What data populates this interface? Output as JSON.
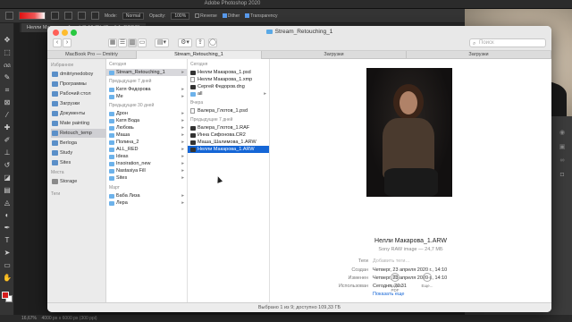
{
  "photoshop": {
    "app_title": "Adobe Photoshop 2020",
    "options": {
      "mode_label": "Mode:",
      "mode_value": "Normal",
      "opacity_label": "Opacity:",
      "opacity_value": "100%",
      "reverse_label": "Reverse",
      "dither_label": "Dither",
      "transparency_label": "Transparency",
      "reverse_checked": false,
      "dither_checked": true,
      "transparency_checked": true
    },
    "doc_tab": "Нелли Макарова_1.psd @ 16,7% (Слой 1, RGB/8)",
    "status_zoom": "16,67%",
    "status_doc": "4000 px x 6000 px (300 ppi)",
    "fg_color": "#d41c1c",
    "bg_color": "#ffffff"
  },
  "finder": {
    "window_title": "Stream_Retouching_1",
    "search_placeholder": "Поиск",
    "path_tabs": [
      "MacBook Pro — Dmitriy",
      "Stream_Retouching_1",
      "Загрузки",
      "Загрузки"
    ],
    "sidebar": {
      "favorites_heading": "Избранное",
      "favorites": [
        "dmitriynedoboy",
        "Программы",
        "Рабочий стол",
        "Загрузки",
        "Документы",
        "Mate painting",
        "Retouch_temp",
        "Berloga",
        "Study",
        "Sites"
      ],
      "selected_index": 6,
      "places_heading": "Места",
      "places": [
        "Storage"
      ],
      "tags_heading": "Теги"
    },
    "column1": {
      "today_heading": "Сегодня",
      "today": [
        {
          "label": "Stream_Retouching_1",
          "selected": true
        }
      ],
      "prev7_heading": "Предыдущие 7 дней",
      "prev7": [
        "Катя Федорова",
        "Me"
      ],
      "prev30_heading": "Предыдущие 30 дней",
      "prev30": [
        "Дрон",
        "Катя Вода",
        "Любовь",
        "Маша",
        "Полина_2",
        "ALL_RED",
        "Ideas",
        "Insoiration_new",
        "Nastasiya Fill",
        "Sites"
      ],
      "march_heading": "Март",
      "march": [
        "Баба Лиза",
        "Лера"
      ]
    },
    "column2": {
      "today_heading": "Сегодня",
      "today": [
        "Нелли Макарова_1.psd",
        "Нелли Макарова_1.xmp",
        "Сергей Федоров.dng",
        "all"
      ],
      "yesterday_heading": "Вчера",
      "yesterday": [
        "Валера_Глотов_1.psd"
      ],
      "prev7_heading": "Предыдущие 7 дней",
      "prev7": [
        "Валера_Глотов_1.RAF",
        "Инна Сифонова.CR2",
        "Маша_Шалимова_1.ARW",
        "Нелли Макарова_1.ARW"
      ],
      "highlight": "Нелли Макарова_1.ARW"
    },
    "preview": {
      "file_name": "Нелли Макарова_1.ARW",
      "file_kind": "Sony RAW image — 24,7 МБ",
      "tags_key": "Теги",
      "tags_value": "Добавить теги…",
      "created_key": "Создан",
      "created_value": "Четверг, 23 апреля 2020 г., 14:10",
      "modified_key": "Изменен",
      "modified_value": "Четверг, 23 апреля 2020 г., 14:10",
      "used_key": "Использован",
      "used_value": "Сегодня, 20:31",
      "show_more": "Показать еще",
      "action_pdf": "Создать PDF",
      "action_more": "Еще..."
    },
    "status_text": "Выбрано 1 из 9; доступно 109,33 ГБ"
  }
}
